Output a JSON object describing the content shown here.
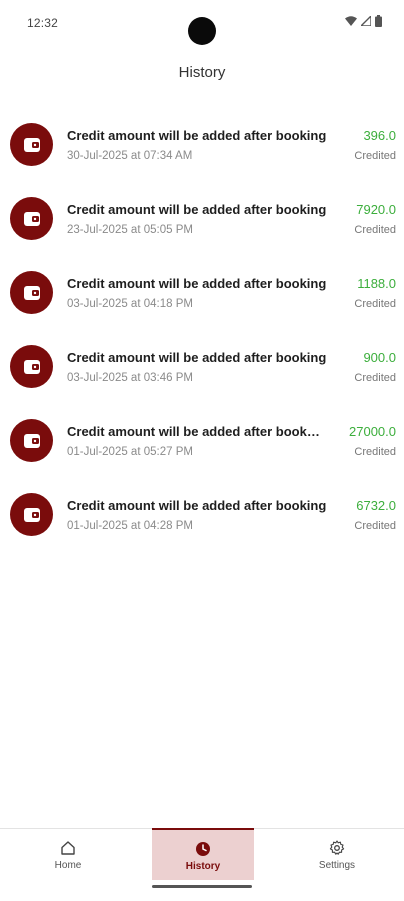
{
  "status_bar": {
    "time": "12:32",
    "icons": [
      "wifi-icon",
      "signal-icon",
      "battery-icon"
    ]
  },
  "header": {
    "title": "History"
  },
  "history": {
    "items": [
      {
        "title": "Credit amount will be added after booking",
        "date": "30-Jul-2025 at 07:34 AM",
        "amount": "396.0",
        "status": "Credited"
      },
      {
        "title": "Credit amount will be added after booking",
        "date": "23-Jul-2025 at 05:05 PM",
        "amount": "7920.0",
        "status": "Credited"
      },
      {
        "title": "Credit amount will be added after booking",
        "date": "03-Jul-2025 at 04:18 PM",
        "amount": "1188.0",
        "status": "Credited"
      },
      {
        "title": "Credit amount will be added after booking",
        "date": "03-Jul-2025 at 03:46 PM",
        "amount": "900.0",
        "status": "Credited"
      },
      {
        "title": "Credit amount will be added after booking",
        "date": "01-Jul-2025 at 05:27 PM",
        "amount": "27000.0",
        "status": "Credited"
      },
      {
        "title": "Credit amount will be added after booking",
        "date": "01-Jul-2025 at 04:28 PM",
        "amount": "6732.0",
        "status": "Credited"
      }
    ]
  },
  "bottom_nav": {
    "items": [
      {
        "label": "Home",
        "icon": "home-icon",
        "active": false
      },
      {
        "label": "History",
        "icon": "clock-icon",
        "active": true
      },
      {
        "label": "Settings",
        "icon": "gear-icon",
        "active": false
      }
    ]
  },
  "colors": {
    "accent": "#7a0c0c",
    "amount": "#3cae3c",
    "active_tab_bg": "#ecd0d0"
  }
}
